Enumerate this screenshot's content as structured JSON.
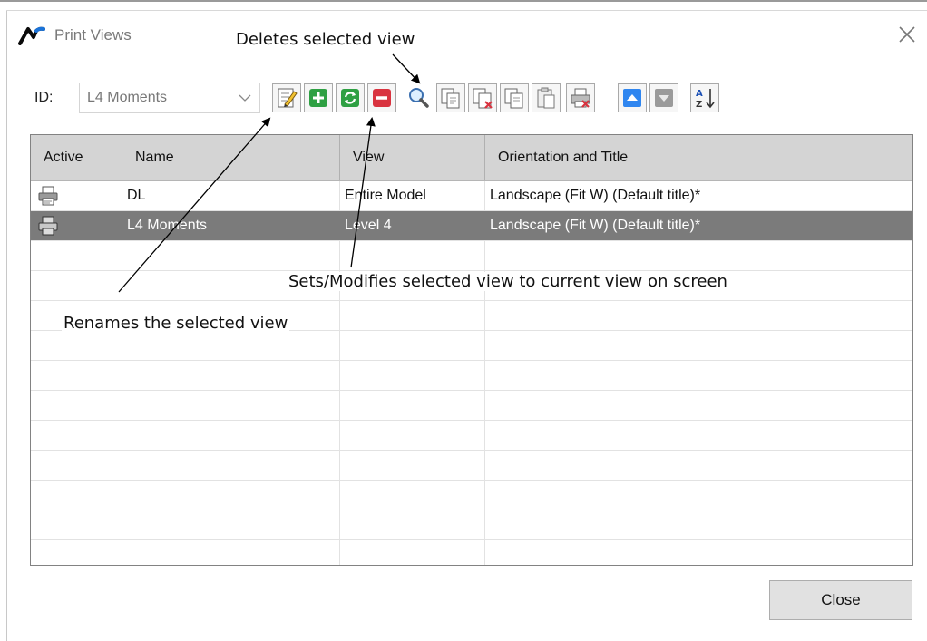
{
  "window": {
    "title": "Print Views"
  },
  "id_field": {
    "label": "ID:",
    "value": "L4 Moments"
  },
  "toolbar": {
    "buttons": [
      {
        "icon": "rename-icon"
      },
      {
        "icon": "add-icon",
        "color": "#2ea043"
      },
      {
        "icon": "refresh-icon",
        "color": "#2ea043"
      },
      {
        "icon": "delete-icon",
        "color": "#d9333f"
      },
      {
        "icon": "zoom-icon"
      },
      {
        "icon": "copy-to-icon"
      },
      {
        "icon": "copy-delete-icon"
      },
      {
        "icon": "copy-icon"
      },
      {
        "icon": "paste-icon"
      },
      {
        "icon": "print-delete-icon"
      },
      {
        "icon": "move-up-icon",
        "color": "#2f86f0"
      },
      {
        "icon": "move-down-icon"
      },
      {
        "icon": "sort-az-icon"
      }
    ]
  },
  "table": {
    "headers": [
      "Active",
      "Name",
      "View",
      "Orientation and Title"
    ],
    "rows": [
      {
        "active_icon": "printer-icon",
        "name": "DL",
        "view": "Entire Model",
        "orientation": "Landscape (Fit W) (Default title)*",
        "selected": false
      },
      {
        "active_icon": "printer-icon",
        "name": "L4 Moments",
        "view": "Level 4",
        "orientation": "Landscape (Fit W) (Default title)*",
        "selected": true
      }
    ]
  },
  "annotations": {
    "delete": "Deletes selected view",
    "rename": "Renames the selected view",
    "set": "Sets/Modifies selected view to current view on screen"
  },
  "buttons": {
    "close": "Close"
  },
  "colors": {
    "selected_row": "#7b7b7b",
    "header_bg": "#d4d4d4",
    "accent_blue": "#2f86f0"
  }
}
